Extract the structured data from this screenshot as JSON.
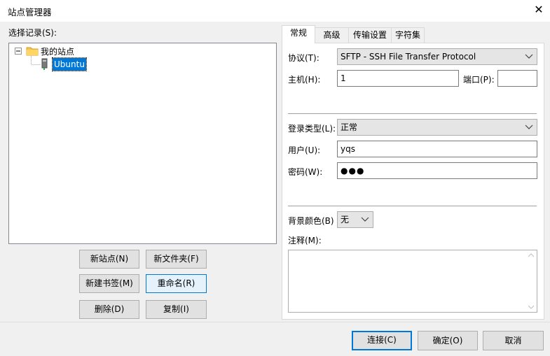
{
  "window": {
    "title": "站点管理器",
    "close_glyph": "✕"
  },
  "left": {
    "select_label": "选择记录(S):",
    "tree": {
      "root": "我的站点",
      "child": "Ubuntu"
    },
    "buttons": {
      "new_site": "新站点(N)",
      "new_folder": "新文件夹(F)",
      "new_bookmark": "新建书签(M)",
      "rename": "重命名(R)",
      "delete": "删除(D)",
      "copy": "复制(I)"
    }
  },
  "tabs": [
    "常规",
    "高级",
    "传输设置",
    "字符集"
  ],
  "general": {
    "protocol_label": "协议(T):",
    "protocol_value": "SFTP - SSH File Transfer Protocol",
    "host_label": "主机(H):",
    "host_value": "1",
    "port_label": "端口(P):",
    "port_value": "",
    "logon_type_label": "登录类型(L):",
    "logon_type_value": "正常",
    "user_label": "用户(U):",
    "user_value": "yqs",
    "password_label": "密码(W):",
    "password_value": "●●●",
    "bgcolor_label": "背景颜色(B)",
    "bgcolor_value": "无",
    "comment_label": "注释(M):",
    "comment_value": ""
  },
  "footer": {
    "connect": "连接(C)",
    "ok": "确定(O)",
    "cancel": "取消"
  },
  "colors": {
    "accent": "#0078d7",
    "selection": "#0078d7",
    "folder": "#f4c24d"
  }
}
